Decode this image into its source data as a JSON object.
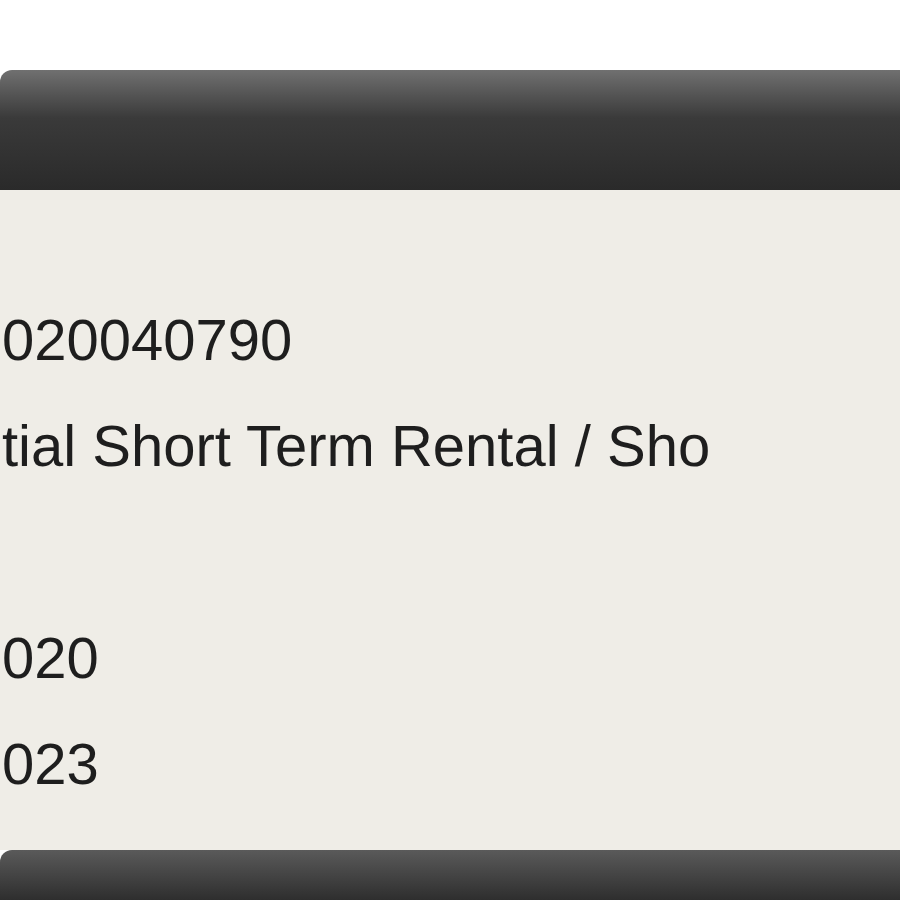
{
  "sections": [
    {
      "lines": [
        "020040790",
        "tial Short Term Rental / Sho"
      ]
    },
    {
      "lines": [
        "020",
        "023"
      ]
    }
  ]
}
